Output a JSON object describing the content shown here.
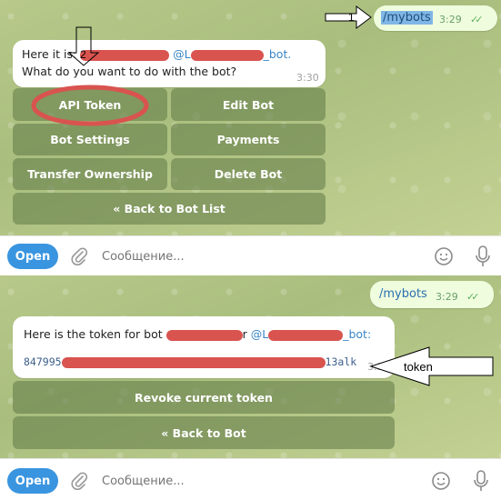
{
  "top": {
    "outgoing": {
      "text": "/mybots",
      "time": "3:29",
      "checks": "✓✓"
    },
    "incoming": {
      "line1_prefix": "Here it is:",
      "mention_prefix": "@L",
      "mention_suffix": "_bot.",
      "line2": "What do you want to do with the bot?",
      "time": "3:30"
    },
    "keyboard": {
      "api_token": "API Token",
      "edit_bot": "Edit Bot",
      "bot_settings": "Bot Settings",
      "payments": "Payments",
      "transfer_ownership": "Transfer Ownership",
      "delete_bot": "Delete Bot",
      "back_to_bot_list": "« Back to Bot List"
    },
    "input": {
      "open_label": "Open",
      "placeholder": "Сообщение..."
    }
  },
  "bottom": {
    "outgoing": {
      "text": "/mybots",
      "time": "3:29",
      "checks": "✓✓"
    },
    "incoming": {
      "line1_prefix": "Here is the token for bot",
      "line1_mid": "r",
      "mention_prefix": "@L",
      "mention_suffix": "_bot:",
      "token_prefix": "847995",
      "token_suffix": "13alk",
      "time": "3:3"
    },
    "keyboard": {
      "revoke": "Revoke current token",
      "back_to_bot": "« Back to Bot"
    },
    "input": {
      "open_label": "Open",
      "placeholder": "Сообщение..."
    }
  },
  "annotations": {
    "arrow1": "1",
    "arrow2": "2",
    "token_arrow": "token"
  },
  "colors": {
    "redaction": "#d9534f",
    "open_button": "#3a95e0",
    "highlight_circle": "#d9534f"
  }
}
